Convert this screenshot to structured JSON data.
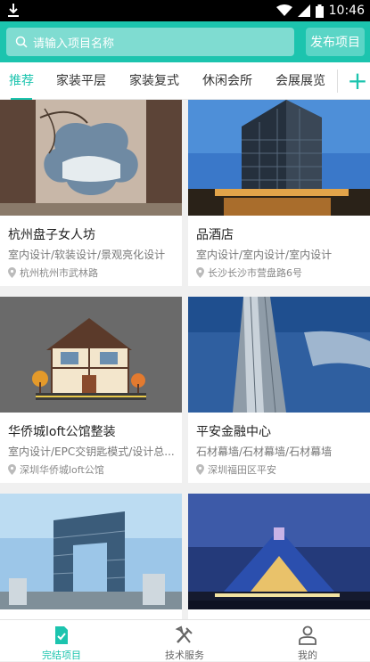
{
  "statusbar": {
    "time": "10:46"
  },
  "header": {
    "search_placeholder": "请输入项目名称",
    "publish_label": "发布项目"
  },
  "tabs": [
    "推荐",
    "家装平层",
    "家装复式",
    "休闲会所",
    "会展展览"
  ],
  "cards": [
    {
      "title": "杭州盘子女人坊",
      "tags": "室内设计/软装设计/景观亮化设计",
      "location": "杭州杭州市武林路"
    },
    {
      "title": "品酒店",
      "tags": "室内设计/室内设计/室内设计",
      "location": "长沙长沙市营盘路6号"
    },
    {
      "title": "华侨城loft公馆整装",
      "tags": "室内设计/EPC交钥匙模式/设计总...",
      "location": "深圳华侨城loft公馆"
    },
    {
      "title": "平安金融中心",
      "tags": "石材幕墙/石材幕墙/石材幕墙",
      "location": "深圳福田区平安"
    },
    {
      "title": "",
      "tags": "",
      "location": ""
    },
    {
      "title": "",
      "tags": "",
      "location": ""
    }
  ],
  "bottom_nav": [
    "完结项目",
    "技术服务",
    "我的"
  ],
  "colors": {
    "accent": "#1cc4ae"
  }
}
